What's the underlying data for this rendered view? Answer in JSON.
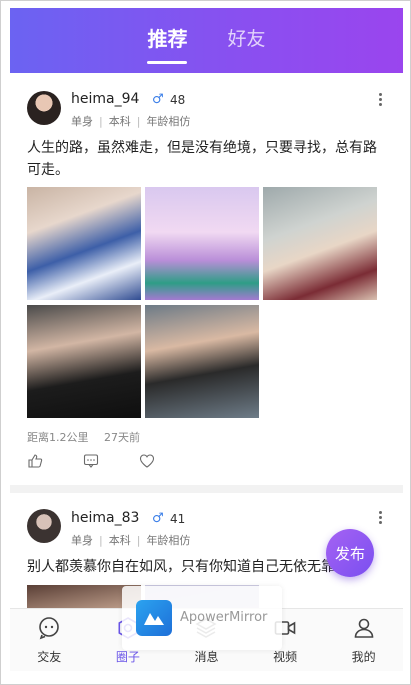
{
  "header": {
    "tabs": [
      {
        "label": "推荐",
        "active": true
      },
      {
        "label": "好友",
        "active": false
      }
    ]
  },
  "posts": [
    {
      "username": "heima_94",
      "gender_icon": "male-symbol",
      "age": "48",
      "meta": [
        "单身",
        "本科",
        "年龄相仿"
      ],
      "text": "人生的路，虽然难走，但是没有绝境，只要寻找，总有路可走。",
      "photos": 5,
      "distance": "距离1.2公里",
      "time": "27天前"
    },
    {
      "username": "heima_83",
      "gender_icon": "male-symbol",
      "age": "41",
      "meta": [
        "单身",
        "本科",
        "年龄相仿"
      ],
      "text": "别人都羡慕你自在如风，只有你知道自己无依无靠"
    }
  ],
  "fab": {
    "label": "发布"
  },
  "overlay": {
    "label": "ApowerMirror"
  },
  "nav": [
    {
      "label": "交友",
      "icon": "chat-bubble-icon"
    },
    {
      "label": "圈子",
      "icon": "circle-hexagon-icon",
      "active": true
    },
    {
      "label": "消息",
      "icon": "layers-icon"
    },
    {
      "label": "视频",
      "icon": "video-camera-icon"
    },
    {
      "label": "我的",
      "icon": "user-icon"
    }
  ],
  "colors": {
    "accent": "#7a56f0",
    "header_start": "#6b63f2",
    "header_end": "#9a45ee"
  }
}
